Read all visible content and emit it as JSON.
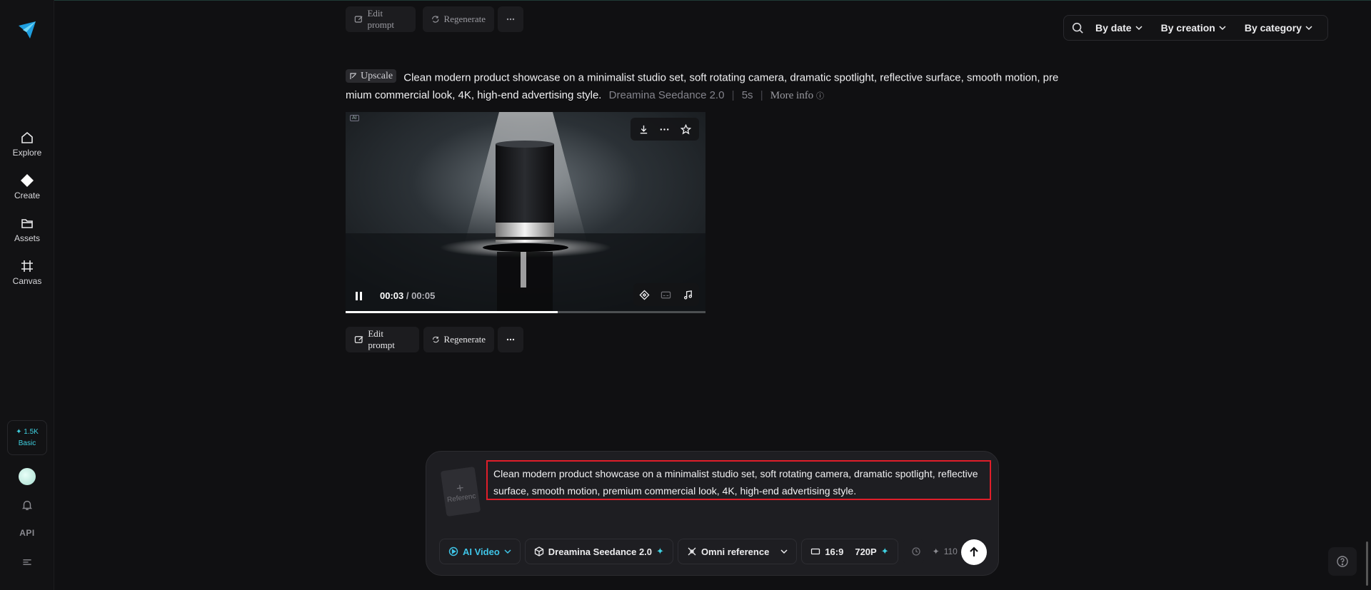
{
  "sidebar": {
    "items": [
      {
        "label": "Explore",
        "icon": "home-icon"
      },
      {
        "label": "Create",
        "icon": "diamond-icon"
      },
      {
        "label": "Assets",
        "icon": "folder-icon"
      },
      {
        "label": "Canvas",
        "icon": "canvas-icon"
      }
    ],
    "credits": "✦ 1.5K",
    "plan": "Basic",
    "api_label": "API"
  },
  "filters": {
    "by_date": "By date",
    "by_creation": "By creation",
    "by_category": "By category"
  },
  "actions": {
    "edit_prompt": "Edit prompt",
    "regenerate": "Regenerate"
  },
  "generation": {
    "upscale_label": "Upscale",
    "prompt": "Clean modern product showcase on a minimalist studio set, soft rotating camera, dramatic spotlight, reflective surface, smooth motion, premium commercial look, 4K, high-end advertising style.",
    "model": "Dreamina Seedance 2.0",
    "duration": "5s",
    "more_info": "More info",
    "ai_tag": "AI"
  },
  "player": {
    "current_time": "00:03",
    "total_time": " / 00:05",
    "progress": 0.59
  },
  "composer": {
    "reference_label": "Referenc",
    "input_value": "Clean modern product showcase on a minimalist studio set, soft rotating camera, dramatic spotlight, reflective surface, smooth motion, premium commercial look, 4K, high-end advertising style.",
    "mode": "AI Video",
    "model": "Dreamina Seedance 2.0",
    "reference_mode": "Omni reference",
    "aspect": "16:9",
    "resolution": "720P",
    "cost": "110"
  },
  "colors": {
    "accent": "#3fc5e8",
    "highlight_border": "#e01e2a",
    "background": "#101012"
  }
}
